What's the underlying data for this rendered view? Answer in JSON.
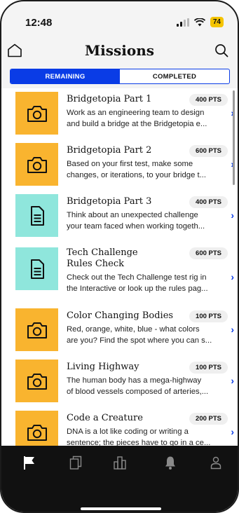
{
  "status": {
    "time": "12:48",
    "battery": "74"
  },
  "header": {
    "title": "Missions",
    "home_icon": "home-icon",
    "search_icon": "search-icon"
  },
  "tabs": [
    {
      "label": "REMAINING",
      "active": true
    },
    {
      "label": "COMPLETED",
      "active": false
    }
  ],
  "missions": [
    {
      "title": "Bridgetopia Part 1",
      "points": "400 PTS",
      "line1": "Work as an engineering team to design",
      "line2": "and build a bridge at the Bridgetopia e...",
      "icon": "camera-icon",
      "color": "#f9b42f"
    },
    {
      "title": "Bridgetopia Part 2",
      "points": "600 PTS",
      "line1": "Based on your first test, make some",
      "line2": "changes, or iterations, to your bridge t...",
      "icon": "camera-icon",
      "color": "#f9b42f"
    },
    {
      "title": "Bridgetopia Part 3",
      "points": "400 PTS",
      "line1": "Think about an unexpected challenge",
      "line2": "your team faced when working togeth...",
      "icon": "document-icon",
      "color": "#8fe6dc"
    },
    {
      "title": "Tech Challenge Rules Check",
      "points": "600 PTS",
      "line1": "Check out the Tech Challenge test rig in",
      "line2": "the Interactive or look up the rules pag...",
      "icon": "document-icon",
      "color": "#8fe6dc"
    },
    {
      "title": "Color Changing Bodies",
      "points": "100 PTS",
      "line1": "Red, orange, white, blue - what colors",
      "line2": "are you? Find the spot where you can s...",
      "icon": "camera-icon",
      "color": "#f9b42f"
    },
    {
      "title": "Living Highway",
      "points": "100 PTS",
      "line1": "The human body has a mega-highway",
      "line2": "of blood vessels composed of arteries,...",
      "icon": "camera-icon",
      "color": "#f9b42f"
    },
    {
      "title": "Code a Creature",
      "points": "200 PTS",
      "line1": "DNA is a lot like coding or writing a",
      "line2": "sentence; the pieces have to go in a ce...",
      "icon": "camera-icon",
      "color": "#f9b42f"
    }
  ],
  "tabbar": [
    {
      "icon": "flag-icon",
      "active": true
    },
    {
      "icon": "cards-icon",
      "active": false
    },
    {
      "icon": "building-icon",
      "active": false
    },
    {
      "icon": "bell-icon",
      "active": false
    },
    {
      "icon": "profile-icon",
      "active": false
    }
  ],
  "colors": {
    "accent": "#0a3ce6",
    "camera_tile": "#f9b42f",
    "document_tile": "#8fe6dc",
    "tabbar": "#111111"
  }
}
